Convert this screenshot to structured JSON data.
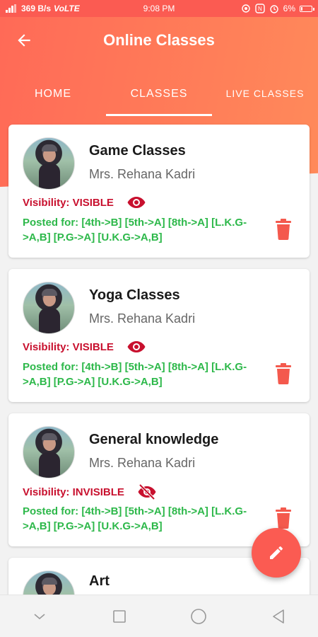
{
  "status_bar": {
    "network_speed": "369 B/s",
    "network_type": "VoLTE",
    "time": "9:08 PM",
    "battery": "6%"
  },
  "toolbar": {
    "title": "Online Classes",
    "back_icon": "arrow-left-icon"
  },
  "tabs": [
    {
      "label": "HOME",
      "active": false
    },
    {
      "label": "CLASSES",
      "active": true
    },
    {
      "label": "LIVE CLASSES",
      "active": false
    }
  ],
  "classes": [
    {
      "title": "Game Classes",
      "teacher": "Mrs. Rehana Kadri",
      "visibility_label": "Visibility: VISIBLE",
      "visibility_icon": "eye-icon",
      "posted_for": "Posted for:  [4th->B] [5th->A] [8th->A] [L.K.G->A,B] [P.G->A] [U.K.G->A,B]"
    },
    {
      "title": "Yoga Classes",
      "teacher": "Mrs. Rehana Kadri",
      "visibility_label": "Visibility: VISIBLE",
      "visibility_icon": "eye-icon",
      "posted_for": "Posted for:  [4th->B] [5th->A] [8th->A] [L.K.G->A,B] [P.G->A] [U.K.G->A,B]"
    },
    {
      "title": "General knowledge",
      "teacher": "Mrs. Rehana Kadri",
      "visibility_label": "Visibility: INVISIBLE",
      "visibility_icon": "eye-off-icon",
      "posted_for": "Posted for:  [4th->B] [5th->A] [8th->A] [L.K.G->A,B] [P.G->A] [U.K.G->A,B]"
    },
    {
      "title": "Art"
    }
  ],
  "fab": {
    "icon": "pencil-icon"
  },
  "colors": {
    "accent": "#fb5b52",
    "visibility_text": "#c8102e",
    "posted_text": "#2db84a",
    "delete": "#f4594d"
  }
}
